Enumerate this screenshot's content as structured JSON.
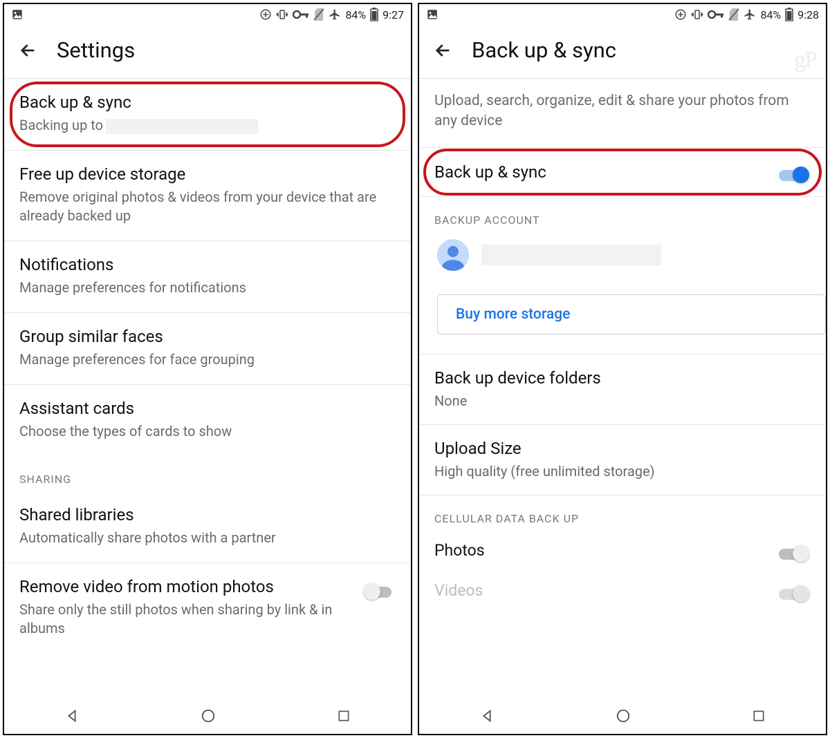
{
  "screen1": {
    "status": {
      "battery": "84%",
      "time": "9:27"
    },
    "title": "Settings",
    "items": [
      {
        "title": "Back up & sync",
        "sub_prefix": "Backing up to"
      },
      {
        "title": "Free up device storage",
        "sub": "Remove original photos & videos from your device that are already backed up"
      },
      {
        "title": "Notifications",
        "sub": "Manage preferences for notifications"
      },
      {
        "title": "Group similar faces",
        "sub": "Manage preferences for face grouping"
      },
      {
        "title": "Assistant cards",
        "sub": "Choose the types of cards to show"
      }
    ],
    "section_sharing": "SHARING",
    "shared_libraries": {
      "title": "Shared libraries",
      "sub": "Automatically share photos with a partner"
    },
    "motion": {
      "title": "Remove video from motion photos",
      "sub": "Share only the still photos when sharing by link & in albums"
    }
  },
  "screen2": {
    "status": {
      "battery": "84%",
      "time": "9:28"
    },
    "title": "Back up & sync",
    "description": "Upload, search, organize, edit & share your photos from any device",
    "toggle_label": "Back up & sync",
    "section_account": "BACKUP ACCOUNT",
    "buy_storage": "Buy more storage",
    "folders": {
      "title": "Back up device folders",
      "sub": "None"
    },
    "upload": {
      "title": "Upload Size",
      "sub": "High quality (free unlimited storage)"
    },
    "section_cell": "CELLULAR DATA BACK UP",
    "cell_photos": "Photos",
    "cell_videos": "Videos",
    "watermark": "gP"
  }
}
